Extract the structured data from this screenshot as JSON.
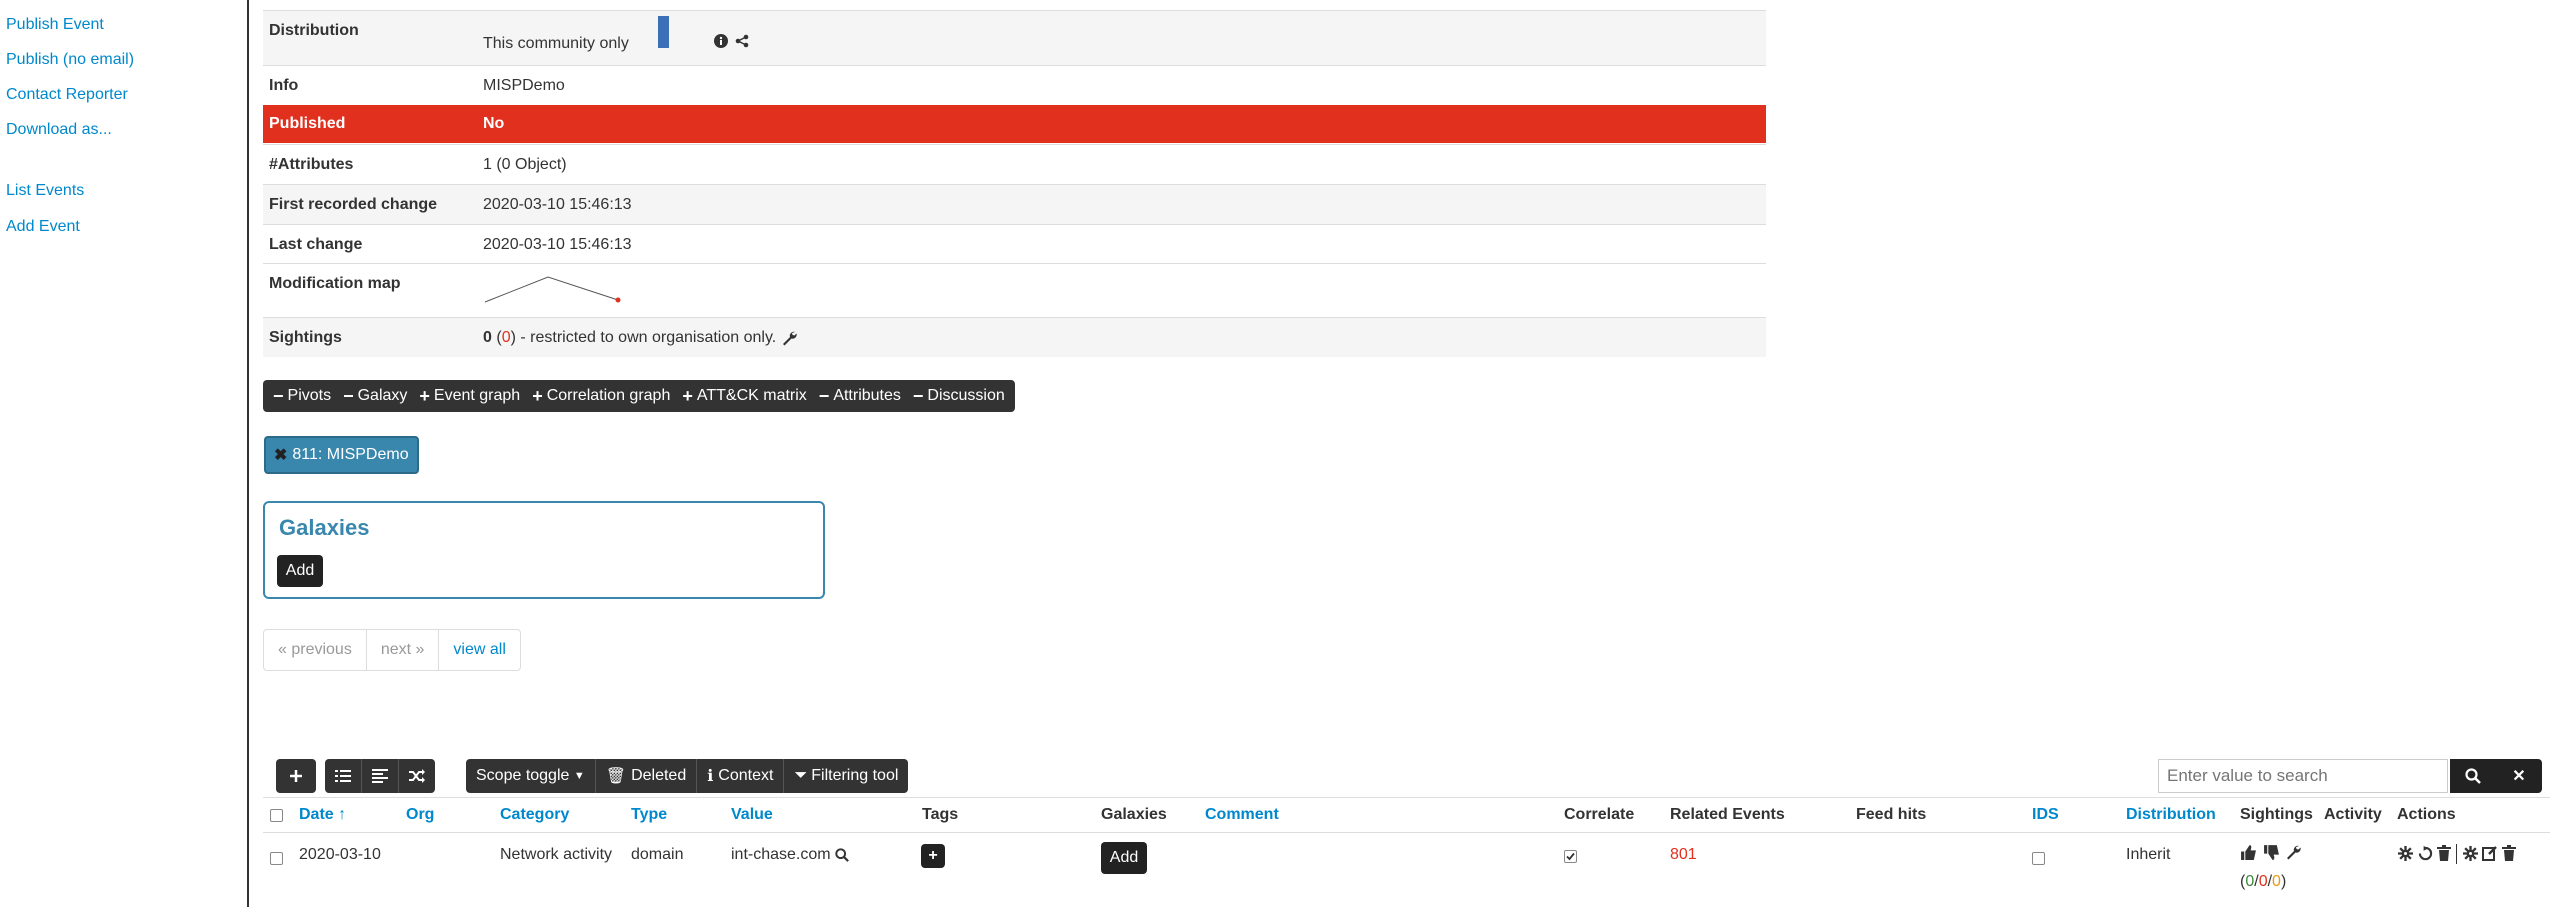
{
  "sidebar": {
    "links": [
      "Publish Event",
      "Publish (no email)",
      "Contact Reporter",
      "Download as..."
    ],
    "links2": [
      "List Events",
      "Add Event"
    ]
  },
  "meta": {
    "distribution_label": "Distribution",
    "distribution_value": "This community only",
    "info_label": "Info",
    "info_value": "MISPDemo",
    "published_label": "Published",
    "published_value": "No",
    "attributes_label": "#Attributes",
    "attributes_value": "1 (0 Object)",
    "first_change_label": "First recorded change",
    "first_change_value": "2020-03-10 15:46:13",
    "last_change_label": "Last change",
    "last_change_value": "2020-03-10 15:46:13",
    "modification_label": "Modification map",
    "sightings_label": "Sightings",
    "sightings_count": "0",
    "sightings_paren": "0",
    "sightings_text": "- restricted to own organisation only.",
    "colors": {
      "published_bg": "#e2301f",
      "distribution_bar": "#3b6fb6"
    }
  },
  "toggles": [
    {
      "sym": "−",
      "label": "Pivots"
    },
    {
      "sym": "−",
      "label": "Galaxy"
    },
    {
      "sym": "+",
      "label": "Event graph"
    },
    {
      "sym": "+",
      "label": "Correlation graph"
    },
    {
      "sym": "+",
      "label": "ATT&CK matrix"
    },
    {
      "sym": "−",
      "label": "Attributes"
    },
    {
      "sym": "−",
      "label": "Discussion"
    }
  ],
  "pivot": {
    "label": "811: MISPDemo",
    "icon": "close-icon"
  },
  "galaxies": {
    "title": "Galaxies",
    "add_label": "Add"
  },
  "pager": {
    "previous": "« previous",
    "next": "next »",
    "view_all": "view all"
  },
  "toolbar": {
    "scope_toggle": "Scope toggle",
    "deleted": "Deleted",
    "context": "Context",
    "filtering": "Filtering tool",
    "search_placeholder": "Enter value to search"
  },
  "table": {
    "headers": {
      "date": "Date ↑",
      "org": "Org",
      "category": "Category",
      "type": "Type",
      "value": "Value",
      "tags": "Tags",
      "galaxies": "Galaxies",
      "comment": "Comment",
      "correlate": "Correlate",
      "related": "Related Events",
      "feed": "Feed hits",
      "ids": "IDS",
      "distribution": "Distribution",
      "sightings": "Sightings",
      "activity": "Activity",
      "actions": "Actions"
    },
    "row": {
      "date": "2020-03-10",
      "category": "Network activity",
      "type": "domain",
      "value": "int-chase.com",
      "galaxies_add": "Add",
      "tags_add": "+",
      "related": "801",
      "distribution": "Inherit",
      "sightings_open": "(",
      "sightings_a": "0",
      "sightings_b": "0",
      "sightings_c": "0",
      "sightings_close": ")",
      "sep": "/"
    }
  }
}
